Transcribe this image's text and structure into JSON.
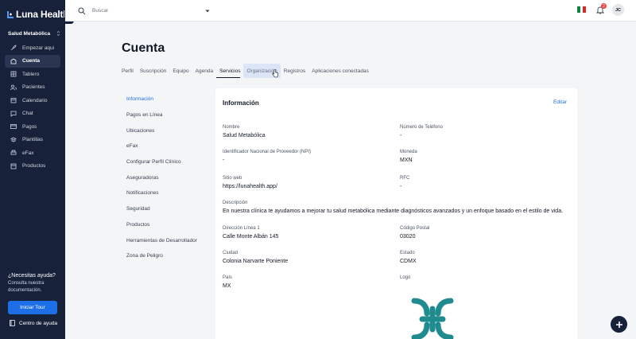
{
  "app": {
    "name": "Luna Health"
  },
  "sidebar": {
    "organization": "Salud Metabólica",
    "items": [
      {
        "label": "Empezar aqui",
        "icon": "rocket-icon"
      },
      {
        "label": "Cuenta",
        "icon": "building-icon",
        "active": true
      },
      {
        "label": "Tablero",
        "icon": "grid-icon"
      },
      {
        "label": "Pacientes",
        "icon": "users-icon"
      },
      {
        "label": "Calendario",
        "icon": "calendar-icon"
      },
      {
        "label": "Chat",
        "icon": "chat-icon"
      },
      {
        "label": "Pagos",
        "icon": "credit-card-icon"
      },
      {
        "label": "Plantillas",
        "icon": "layers-icon"
      },
      {
        "label": "eFax",
        "icon": "printer-icon"
      },
      {
        "label": "Productos",
        "icon": "box-icon"
      }
    ],
    "help": {
      "title": "¿Necesitas ayuda?",
      "subtitle": "Consulta nuestra documentación.",
      "tour_button": "Iniciar Tour",
      "help_center": "Centro de ayuda"
    }
  },
  "topbar": {
    "search_placeholder": "Buscar",
    "notification_count": "2",
    "avatar_initials": "JC"
  },
  "page": {
    "title": "Cuenta",
    "tabs": [
      {
        "label": "Perfil"
      },
      {
        "label": "Suscripción"
      },
      {
        "label": "Equipo"
      },
      {
        "label": "Agenda"
      },
      {
        "label": "Servicios",
        "active": true
      },
      {
        "label": "Organización",
        "hover": true
      },
      {
        "label": "Registros"
      },
      {
        "label": "Aplicaciones conectadas"
      }
    ],
    "subnav": [
      {
        "label": "Información",
        "active": true
      },
      {
        "label": "Pagos en Línea"
      },
      {
        "label": "Ubicaciones"
      },
      {
        "label": "eFax"
      },
      {
        "label": "Configurar Perfil Clínico"
      },
      {
        "label": "Aseguradoras"
      },
      {
        "label": "Notificaciones"
      },
      {
        "label": "Seguridad"
      },
      {
        "label": "Productos"
      },
      {
        "label": "Herramientas de Desarrollador"
      },
      {
        "label": "Zona de Peligro"
      }
    ]
  },
  "info": {
    "title": "Información",
    "edit_label": "Editar",
    "fields": {
      "nombre": {
        "label": "Nombre",
        "value": "Salud Metabólica"
      },
      "telefono": {
        "label": "Número de Teléfono",
        "value": "-"
      },
      "npi": {
        "label": "Identificador Nacional de Proveedor (NPI)",
        "value": "-"
      },
      "moneda": {
        "label": "Moneda",
        "value": "MXN"
      },
      "sitio": {
        "label": "Sitio web",
        "value": "https://lunahealth.app/"
      },
      "rfc": {
        "label": "RFC",
        "value": "-"
      },
      "descripcion": {
        "label": "Descripción",
        "value": "En nuestra clínica te ayudamos a mejorar tu salud metabólica mediante diagnósticos avanzados y un enfoque basado en el estilo de vida."
      },
      "direccion": {
        "label": "Dirección Línea 1",
        "value": "Calle Monte Albán 145"
      },
      "cp": {
        "label": "Código Postal",
        "value": "03020"
      },
      "ciudad": {
        "label": "Ciudad",
        "value": "Colonia Narvarte Poniente"
      },
      "estado": {
        "label": "Estado",
        "value": "CDMX"
      },
      "pais": {
        "label": "País",
        "value": "MX"
      },
      "logo": {
        "label": "Logo"
      }
    }
  },
  "colors": {
    "sidebar_bg": "#17213a",
    "accent": "#1d6fe8",
    "logo_teal": "#1f8b8f"
  }
}
